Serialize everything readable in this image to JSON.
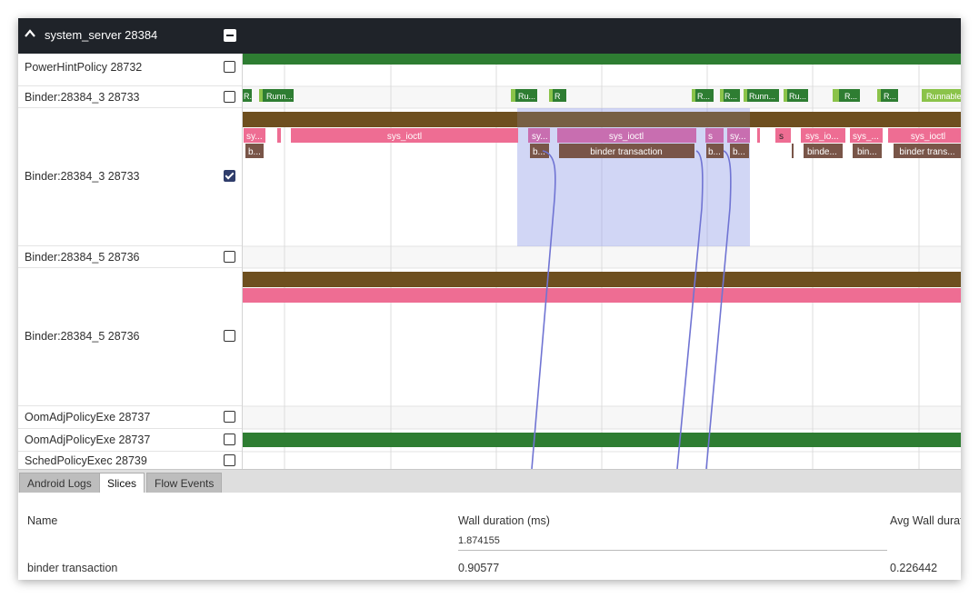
{
  "process": {
    "title": "system_server 28384"
  },
  "threads": [
    {
      "name": "PowerHintPolicy 28732",
      "checked": false
    },
    {
      "name": "Binder:28384_3 28733",
      "checked": false
    },
    {
      "name": "Binder:28384_3 28733",
      "checked": true
    },
    {
      "name": "Binder:28384_5 28736",
      "checked": false
    },
    {
      "name": "Binder:28384_5 28736",
      "checked": false
    },
    {
      "name": "OomAdjPolicyExe 28737",
      "checked": false
    },
    {
      "name": "OomAdjPolicyExe 28737",
      "checked": false
    },
    {
      "name": "SchedPolicyExec 28739",
      "checked": false
    }
  ],
  "track_labels": {
    "state_r_short": "R...",
    "state_ru": "Ru...",
    "state_r": "R",
    "state_runn": "Runn...",
    "state_runnable": "Runnable",
    "sys_ioctl": "sys_ioctl",
    "sys_ioctl_short": "sy...",
    "sys_io_short": "sys_io...",
    "sys_short": "sys_...",
    "sys_s": "s",
    "binder_transaction": "binder transaction",
    "binder_b": "b...",
    "binder_short": "binde...",
    "binder_bin": "bin...",
    "binder_trans": "binder trans..."
  },
  "colors": {
    "header_bg": "#1f2329",
    "running_green": "#2e7d32",
    "runnable_green": "#8bc34a",
    "binder_brown": "#795548",
    "sys_pink": "#ee6d93",
    "selection": "#9aa5e8",
    "flow_line": "#7074d3"
  },
  "tabs": [
    {
      "label": "Android Logs",
      "active": false
    },
    {
      "label": "Slices",
      "active": true
    },
    {
      "label": "Flow Events",
      "active": false
    }
  ],
  "table": {
    "headers": {
      "name": "Name",
      "wall": "Wall duration (ms)",
      "avg": "Avg Wall durat"
    },
    "total_wall": "1.874155",
    "rows": [
      {
        "name": "binder transaction",
        "wall": "0.90577",
        "avg": "0.226442"
      }
    ]
  }
}
